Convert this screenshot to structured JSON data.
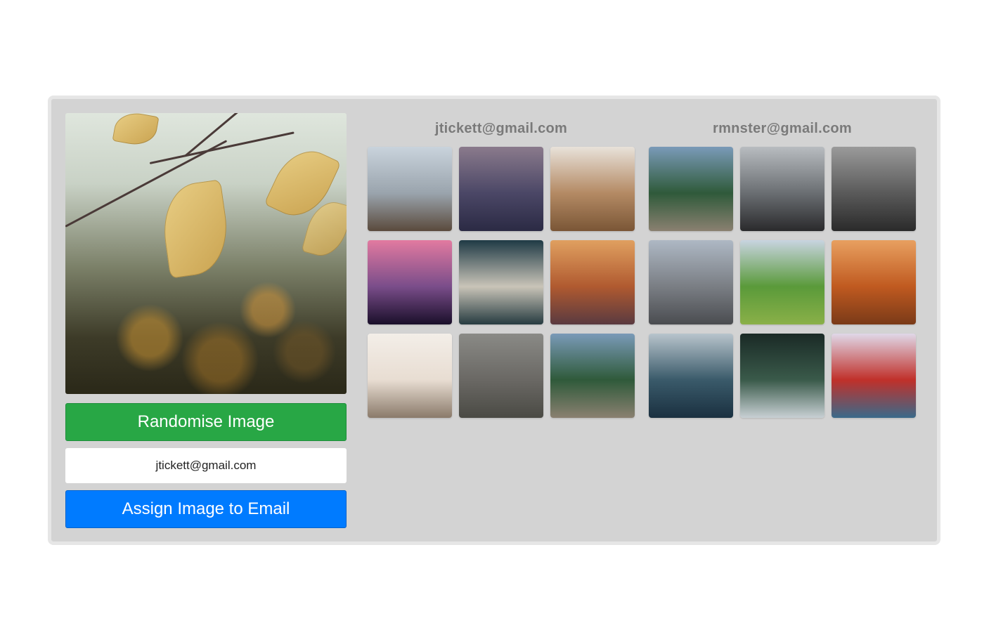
{
  "editor": {
    "main_image": {
      "alt": "autumn leaves on branch",
      "icon": "photo-icon"
    },
    "randomise_label": "Randomise Image",
    "email_value": "jtickett@gmail.com",
    "assign_label": "Assign Image to Email"
  },
  "groups": [
    {
      "email": "jtickett@gmail.com",
      "thumbs": [
        {
          "alt": "legs standing on rocky ground",
          "colors": [
            "#c9d3dc",
            "#9aa4ad",
            "#5a4a3c"
          ]
        },
        {
          "alt": "starry purple night sky",
          "colors": [
            "#8a7a8c",
            "#4b4766",
            "#2b2a44"
          ]
        },
        {
          "alt": "hand holding phone on wooden table",
          "colors": [
            "#e8e2da",
            "#b48a64",
            "#7a5636"
          ]
        },
        {
          "alt": "pink sunset clouds",
          "colors": [
            "#e27aa0",
            "#7a4d8a",
            "#1a0f2a"
          ]
        },
        {
          "alt": "cross against cloudy sky",
          "colors": [
            "#1f3a45",
            "#c9c4b8",
            "#263b40"
          ]
        },
        {
          "alt": "bird in orange clouds",
          "colors": [
            "#e0a060",
            "#b05a30",
            "#5a3a40"
          ]
        },
        {
          "alt": "palm trees on beach",
          "colors": [
            "#f3eee8",
            "#e8ddd2",
            "#8a7a6a"
          ]
        },
        {
          "alt": "woman reflected in window",
          "colors": [
            "#8a8a86",
            "#6a6864",
            "#4a4a44"
          ]
        },
        {
          "alt": "wooden pier by mountain lake",
          "colors": [
            "#7a9ab8",
            "#2f5a3a",
            "#8a8070"
          ]
        }
      ]
    },
    {
      "email": "rmnster@gmail.com",
      "thumbs": [
        {
          "alt": "wooden pier by mountain lake",
          "colors": [
            "#7a9ab8",
            "#2f5a3a",
            "#8a8070"
          ]
        },
        {
          "alt": "steering wheel city view",
          "colors": [
            "#b8bcc0",
            "#6a6e72",
            "#2a2a2c"
          ]
        },
        {
          "alt": "blurred cyclists",
          "colors": [
            "#9a9a9a",
            "#5a5a5a",
            "#2a2a2a"
          ]
        },
        {
          "alt": "snowy mountain range",
          "colors": [
            "#aeb8c4",
            "#7a7e84",
            "#4a4c50"
          ]
        },
        {
          "alt": "green mountain valley",
          "colors": [
            "#c8d4e0",
            "#5a9a3a",
            "#8ab048"
          ]
        },
        {
          "alt": "orange mountains at sunset",
          "colors": [
            "#e8a060",
            "#c05a20",
            "#7a3a18"
          ]
        },
        {
          "alt": "sea with distant boat",
          "colors": [
            "#b8c4cc",
            "#3a5a6a",
            "#1a3040"
          ]
        },
        {
          "alt": "underside of green bridge",
          "colors": [
            "#1a2a26",
            "#3a5a4a",
            "#c8d0d4"
          ]
        },
        {
          "alt": "golden gate bridge",
          "colors": [
            "#e0d8e8",
            "#c0302a",
            "#3a6a8a"
          ]
        }
      ]
    }
  ],
  "colors": {
    "panel_bg": "#d3d3d3",
    "panel_border": "#e6e6e6",
    "randomise": "#28a745",
    "assign": "#007bff",
    "group_title": "#7a7a7a"
  }
}
